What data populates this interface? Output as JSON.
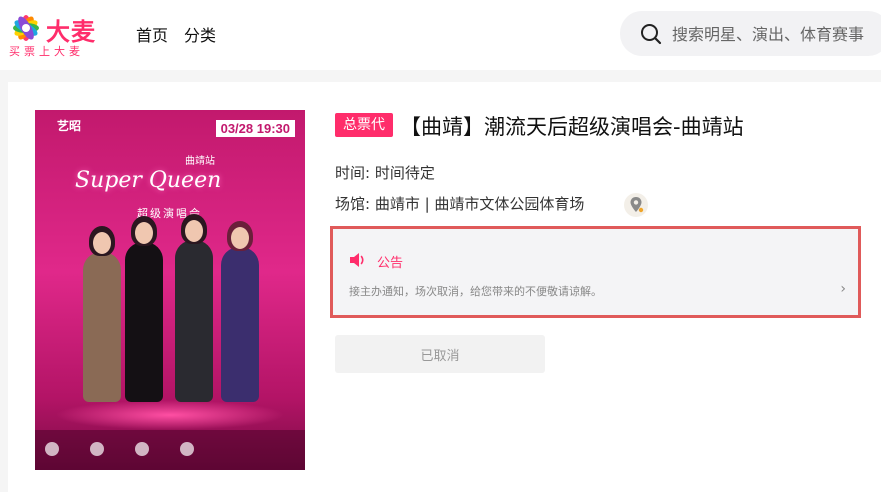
{
  "header": {
    "logo": {
      "main": "大麦",
      "sub": "买票上大麦"
    },
    "nav": [
      {
        "label": "首页"
      },
      {
        "label": "分类"
      }
    ],
    "search": {
      "placeholder": "搜索明星、演出、体育赛事"
    }
  },
  "poster": {
    "brand": "艺昭",
    "date": "03/28 19:30",
    "city": "曲靖站",
    "title": "Super Queen",
    "subtitle": "超级演唱会"
  },
  "event": {
    "badge": "总票代",
    "title": "【曲靖】潮流天后超级演唱会-曲靖站",
    "time_label": "时间:",
    "time_value": "时间待定",
    "venue_label": "场馆:",
    "venue_value": "曲靖市 | 曲靖市文体公园体育场"
  },
  "notice": {
    "label": "公告",
    "text": "接主办通知，场次取消，给您带来的不便敬请谅解。"
  },
  "action": {
    "label": "已取消"
  },
  "colors": {
    "brand": "#ff2d6b",
    "highlight_outline": "#e05a5a"
  }
}
